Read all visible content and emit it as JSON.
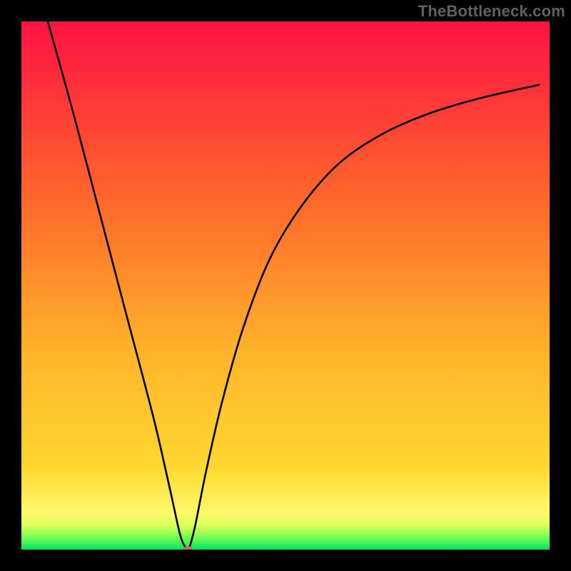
{
  "watermark": "TheBottleneck.com",
  "chart_data": {
    "type": "line",
    "title": "",
    "xlabel": "",
    "ylabel": "",
    "xlim": [
      0,
      100
    ],
    "ylim": [
      0,
      100
    ],
    "grid": false,
    "legend": false,
    "background_gradient": {
      "top": "#ff1244",
      "mid_upper": "#ff6a2a",
      "mid_yellow": "#ffd72e",
      "lower_yellow": "#fff86a",
      "green": "#00e560"
    },
    "series": [
      {
        "name": "bottleneck-curve",
        "color": "#000000",
        "x": [
          5,
          10,
          15,
          20,
          25,
          28,
          30,
          31,
          31.5,
          32,
          33,
          35,
          38,
          42,
          47,
          53,
          60,
          68,
          77,
          87,
          98
        ],
        "y": [
          100,
          82,
          63,
          44,
          25,
          12,
          3,
          0.5,
          0,
          1,
          5,
          15,
          28,
          42,
          55,
          65,
          73,
          78.5,
          82.5,
          85.5,
          88
        ]
      }
    ],
    "marker": {
      "name": "minimum-marker",
      "x": 31.5,
      "y": 0,
      "color": "#c06a6a"
    },
    "frame": {
      "border_color": "#000000",
      "border_width_px": 30
    }
  }
}
